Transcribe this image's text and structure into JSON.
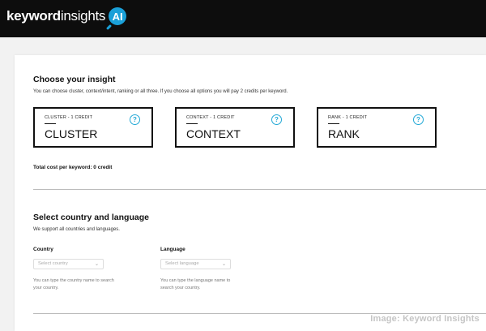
{
  "header": {
    "logo_bold": "keyword",
    "logo_regular": "insights",
    "logo_badge": "AI"
  },
  "insight": {
    "title": "Choose your insight",
    "subtitle": "You can choose cluster, context/intent, ranking or all three. If you choose all options you will pay 2 credits per keyword.",
    "cards": [
      {
        "label": "CLUSTER - 1 CREDIT",
        "title": "CLUSTER",
        "help": "?"
      },
      {
        "label": "CONTEXT - 1 CREDIT",
        "title": "CONTEXT",
        "help": "?"
      },
      {
        "label": "RANK - 1 CREDIT",
        "title": "RANK",
        "help": "?"
      }
    ],
    "total": "Total cost per keyword: 0 credit"
  },
  "locale": {
    "title": "Select country and language",
    "subtitle": "We support all countries and languages.",
    "country": {
      "label": "Country",
      "placeholder": "Select country",
      "hint": "You can type the country name to search your country."
    },
    "language": {
      "label": "Language",
      "placeholder": "Select language",
      "hint": "You can type the language name to search your country."
    }
  },
  "credit": "Image: Keyword Insights",
  "colors": {
    "accent": "#22a8d6",
    "topbar": "#0d0d0d"
  }
}
